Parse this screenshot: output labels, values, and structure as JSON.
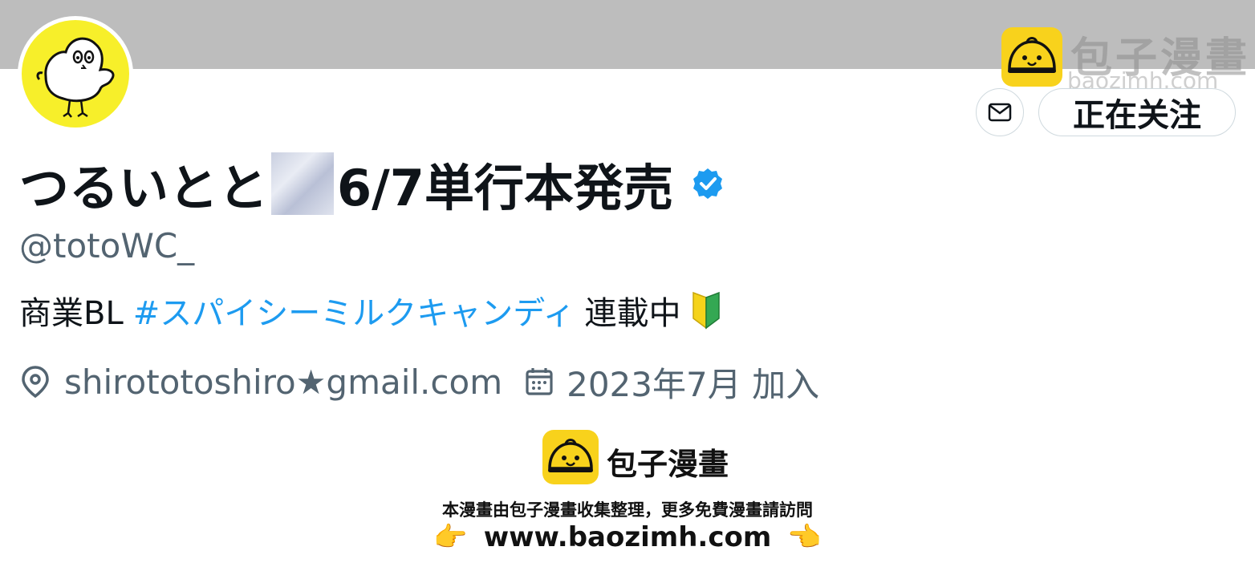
{
  "profile": {
    "display_name_part1": "つるいとと",
    "display_name_part2": "6/7単行本発売",
    "handle": "@totoWC_",
    "bio_prefix": "商業BL",
    "bio_hashtag": "#スパイシーミルクキャンディ",
    "bio_suffix": "連載中",
    "location": "shirototoshiro★gmail.com",
    "joined": "2023年7月 加入"
  },
  "actions": {
    "follow_label": "正在关注"
  },
  "watermark": {
    "title": "包子漫畫",
    "domain": "baozimh.com"
  },
  "footer": {
    "title": "包子漫畫",
    "note": "本漫畫由包子漫畫收集整理，更多免費漫畫請訪問",
    "url": "www.baozimh.com",
    "hand_left": "👉",
    "hand_right": "👈"
  },
  "colors": {
    "banner": "#bdbdbd",
    "accent_blue": "#1d9bf0",
    "secondary_text": "#536471",
    "avatar_yellow": "#f7ef2a",
    "logo_yellow": "#f8d21c"
  },
  "icons": {
    "verified": "verified-badge-icon",
    "message": "mail-icon",
    "location": "location-pin-icon",
    "calendar": "calendar-icon",
    "beginner": "beginner-mark-icon"
  }
}
